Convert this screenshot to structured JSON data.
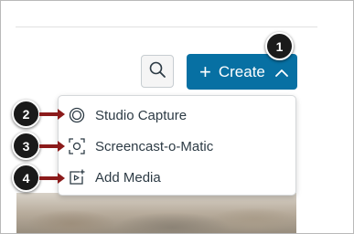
{
  "toolbar": {
    "search_icon": "search-icon",
    "create_button": {
      "plus": "+",
      "label": "Create",
      "caret_icon": "chevron-up-icon",
      "color": "#0770a3"
    }
  },
  "create_menu": {
    "items": [
      {
        "label": "Studio Capture",
        "icon": "studio-capture-icon"
      },
      {
        "label": "Screencast-o-Matic",
        "icon": "screencast-icon"
      },
      {
        "label": "Add Media",
        "icon": "add-media-icon"
      }
    ]
  },
  "callouts": [
    "1",
    "2",
    "3",
    "4"
  ],
  "colors": {
    "accent": "#0770a3",
    "callout_arrow": "#8b1a1a",
    "text": "#2d3b45"
  }
}
